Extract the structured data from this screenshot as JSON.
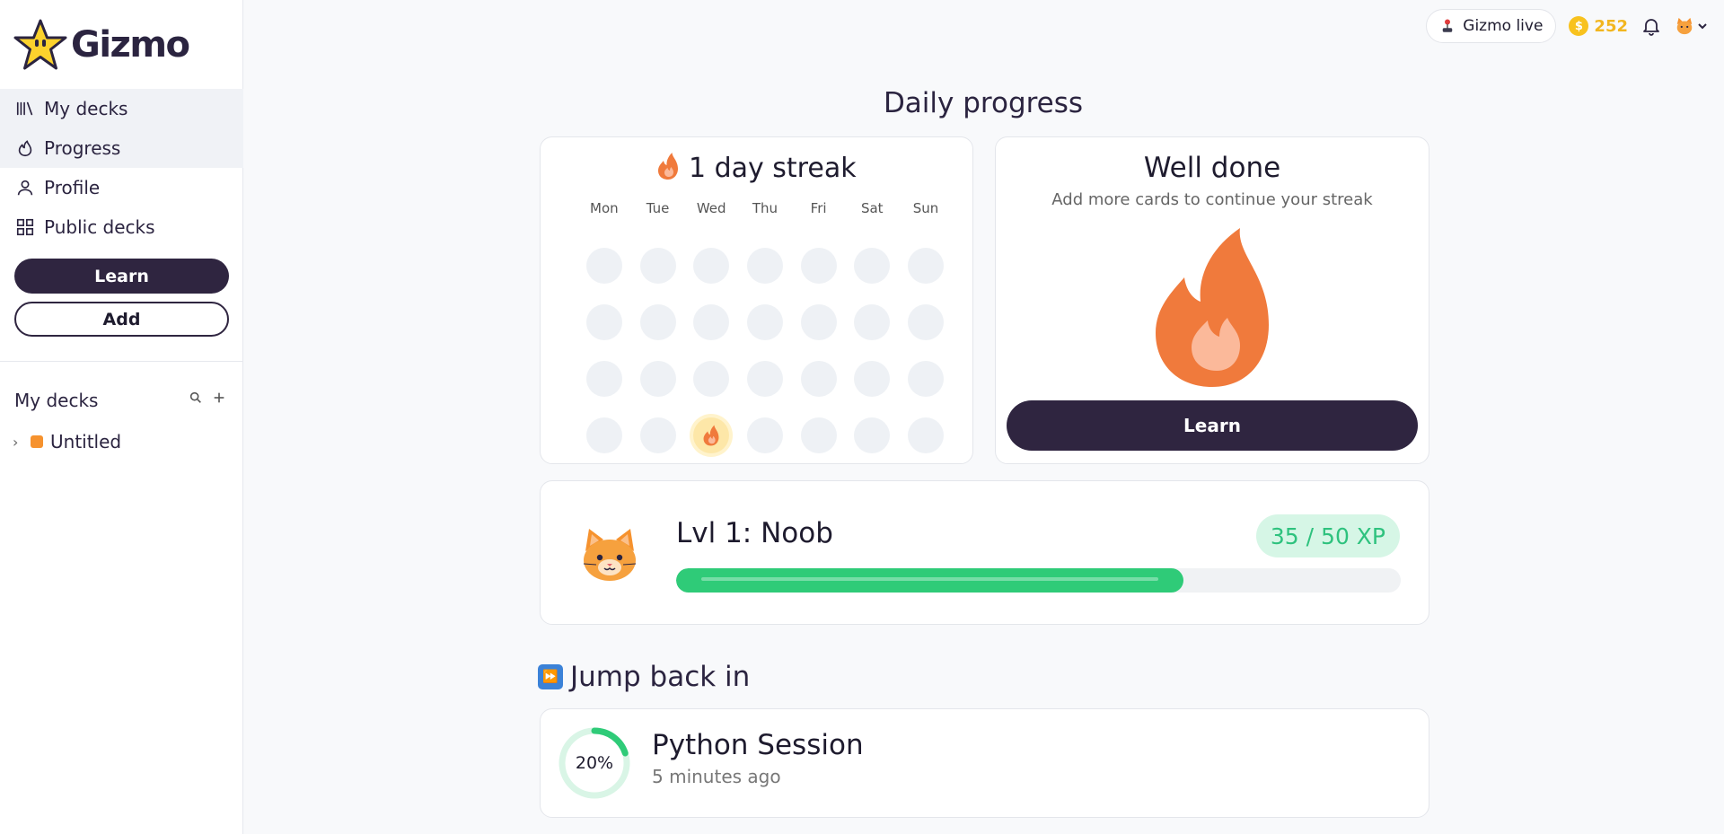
{
  "app": {
    "name": "Gizmo"
  },
  "sidebar": {
    "nav": [
      {
        "label": "My decks",
        "icon": "library-icon",
        "active": true
      },
      {
        "label": "Progress",
        "icon": "flame-outline-icon",
        "active": true
      },
      {
        "label": "Profile",
        "icon": "person-icon",
        "active": false
      },
      {
        "label": "Public decks",
        "icon": "grid-icon",
        "active": false
      }
    ],
    "learn_label": "Learn",
    "add_label": "Add",
    "decks_title": "My decks",
    "decks": [
      {
        "name": "Untitled",
        "color": "#f6922e"
      }
    ]
  },
  "topbar": {
    "live_label": "Gizmo live",
    "coins": "252"
  },
  "main": {
    "title": "Daily progress",
    "streak": {
      "title": "1 day streak",
      "days": [
        "Mon",
        "Tue",
        "Wed",
        "Thu",
        "Fri",
        "Sat",
        "Sun"
      ],
      "active_day_row": 4,
      "active_day_col": 3
    },
    "done": {
      "title": "Well done",
      "subtitle": "Add more cards to continue your streak",
      "learn_label": "Learn"
    },
    "level": {
      "name": "Lvl 1: Noob",
      "xp_label": "35 / 50 XP",
      "progress": 0.7
    },
    "jump": {
      "title": "Jump back in",
      "session_name": "Python Session",
      "session_time": "5 minutes ago",
      "session_percent": "20%",
      "session_progress": 0.2
    }
  },
  "colors": {
    "accent_dark": "#2f2540",
    "flame": "#f07a3c",
    "xp_green": "#2fcb78",
    "coin": "#f8c21e"
  }
}
